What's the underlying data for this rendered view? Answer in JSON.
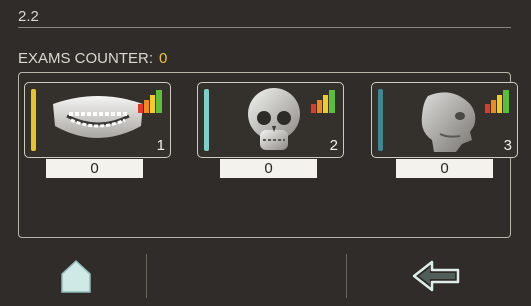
{
  "header": {
    "version": "2.2"
  },
  "counter": {
    "label": "EXAMS COUNTER:",
    "value": "0"
  },
  "exams": [
    {
      "name": "panoramic-jaw",
      "number": "1",
      "count": "0",
      "stripe_color": "#e8c22c"
    },
    {
      "name": "skull-frontal",
      "number": "2",
      "count": "0",
      "stripe_color": "#7fcfc8"
    },
    {
      "name": "skull-lateral",
      "number": "3",
      "count": "0",
      "stripe_color": "#3f8791"
    }
  ],
  "signal_colors": [
    "#e03a2a",
    "#f08a1c",
    "#f2cc1f",
    "#5bbf3a"
  ],
  "nav": {
    "home_icon": "home-icon",
    "back_icon": "back-arrow-icon"
  }
}
